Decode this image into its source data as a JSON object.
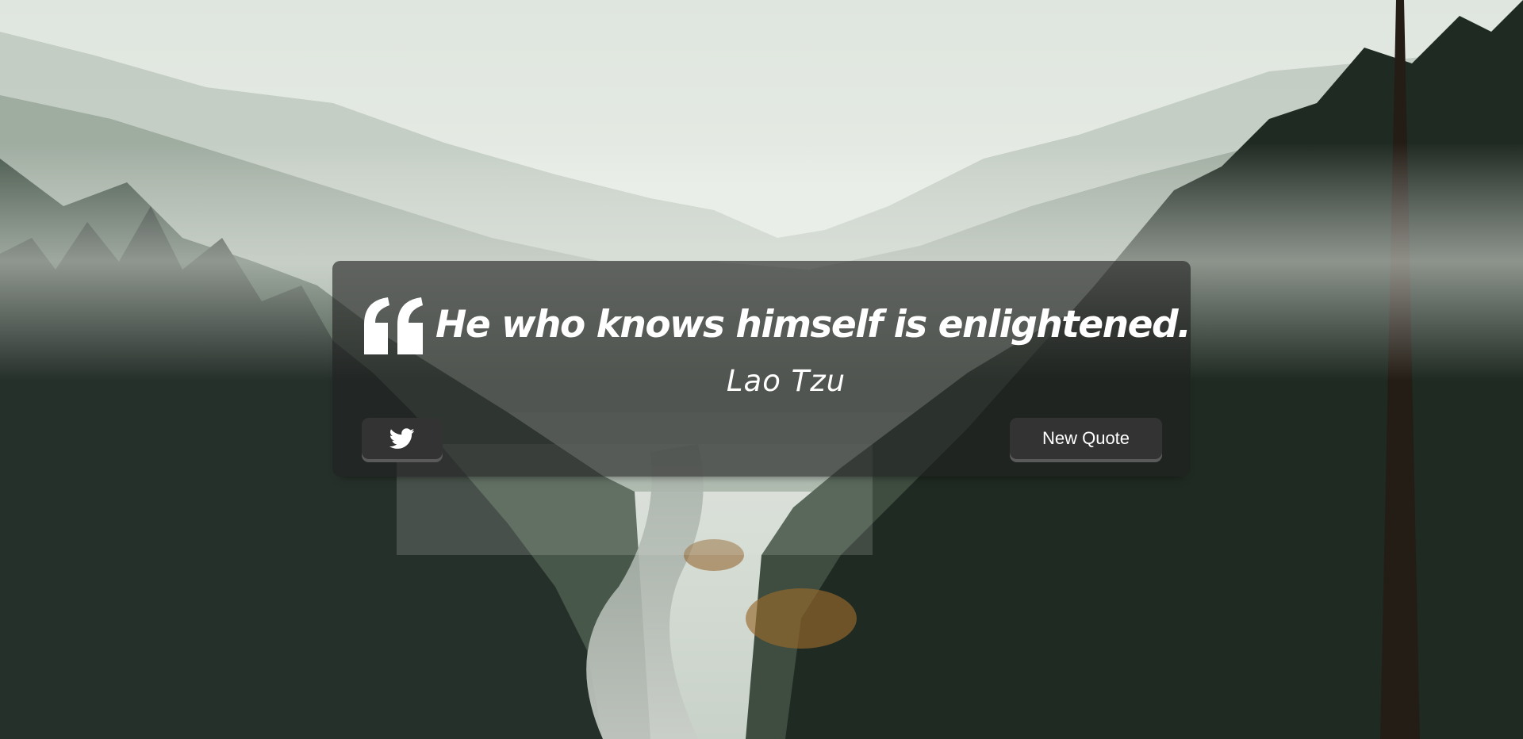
{
  "quote": {
    "text": "He who knows himself is enlightened.",
    "author": "Lao Tzu"
  },
  "buttons": {
    "twitter_icon": "twitter-icon",
    "new_quote_label": "New Quote"
  },
  "icons": {
    "quote_mark": "quote-left-icon"
  },
  "colors": {
    "card_background": "#202020",
    "button_background": "#333333",
    "text": "#ffffff"
  }
}
